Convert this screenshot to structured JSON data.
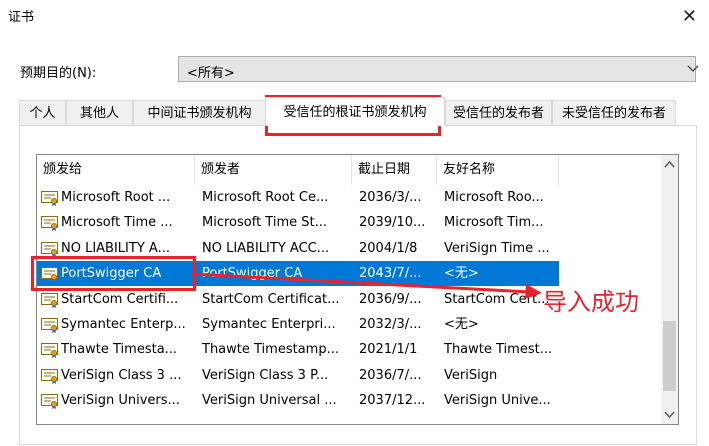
{
  "window": {
    "title": "证书"
  },
  "purpose": {
    "label": "预期目的(N):",
    "selected": "<所有>"
  },
  "tabs": [
    "个人",
    "其他人",
    "中间证书颁发机构",
    "受信任的根证书颁发机构",
    "受信任的发布者",
    "未受信任的发布者"
  ],
  "active_tab_index": 3,
  "table": {
    "columns": [
      "颁发给",
      "颁发者",
      "截止日期",
      "友好名称"
    ],
    "rows": [
      [
        "Microsoft Root ...",
        "Microsoft Root Ce...",
        "2036/3/...",
        "Microsoft Roo..."
      ],
      [
        "Microsoft Time ...",
        "Microsoft Time St...",
        "2039/10...",
        "Microsoft Tim..."
      ],
      [
        "NO LIABILITY A...",
        "NO LIABILITY ACC...",
        "2004/1/8",
        "VeriSign Time ..."
      ],
      [
        "PortSwigger CA",
        "PortSwigger CA",
        "2043/7/...",
        "<无>"
      ],
      [
        "StartCom Certifi...",
        "StartCom Certificat...",
        "2036/9/...",
        "StartCom Cert..."
      ],
      [
        "Symantec Enterp...",
        "Symantec Enterpri...",
        "2032/3/...",
        "<无>"
      ],
      [
        "Thawte Timesta...",
        "Thawte Timestamp...",
        "2021/1/1",
        "Thawte Timest..."
      ],
      [
        "VeriSign Class 3 ...",
        "VeriSign Class 3 P...",
        "2036/7/...",
        "VeriSign"
      ],
      [
        "VeriSign Univers...",
        "VeriSign Universal ...",
        "2037/12...",
        "VeriSign Unive..."
      ]
    ],
    "selected_row_index": 3
  },
  "annotation": {
    "text": "导入成功",
    "color": "#e8242a"
  },
  "icons": {
    "close": "close-icon",
    "dropdown": "chevron-down-icon",
    "cert": "certificate-icon",
    "scroll_up": "scroll-up-icon",
    "scroll_down": "scroll-down-icon"
  },
  "colors": {
    "selection": "#0078d7",
    "annotation": "#e8242a"
  }
}
